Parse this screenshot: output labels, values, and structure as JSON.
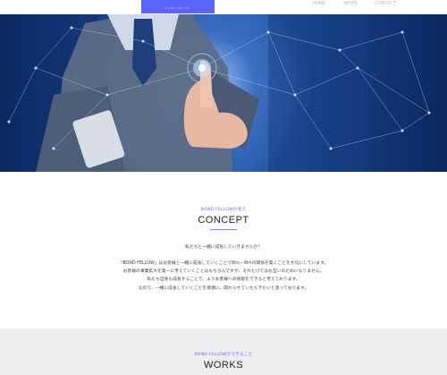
{
  "header": {
    "logo_subtext": "BOND FELLOW",
    "nav": [
      "HOME",
      "NEWS",
      "CONTACT"
    ]
  },
  "hero": {
    "image_alt": "Businessman touching a glowing network node"
  },
  "concept": {
    "kicker": "BOND FELLOWの考え",
    "title": "CONCEPT",
    "lead": "私たちと一緒に成長していきませんか？",
    "paragraph": [
      "「BOND FELLOW」はお客様と一緒に成長していくことでWin－Winの関係を築くことを大切にしています。",
      "お客様の事業拡大を第一に考えていくことはもちろんですが、それだけではお互いのためになりません。",
      "私たち自身も成長することで、よりお客様への貢献をできると考えております。",
      "なので、一緒に成長していくことを目標に、関わらせていただきたいと思っております。"
    ]
  },
  "works": {
    "kicker": "BOND FELLOWができること",
    "title": "WORKS"
  },
  "colors": {
    "accent": "#5b63ff",
    "hero_blue": "#1e4c9a",
    "works_bg": "#efefef"
  }
}
